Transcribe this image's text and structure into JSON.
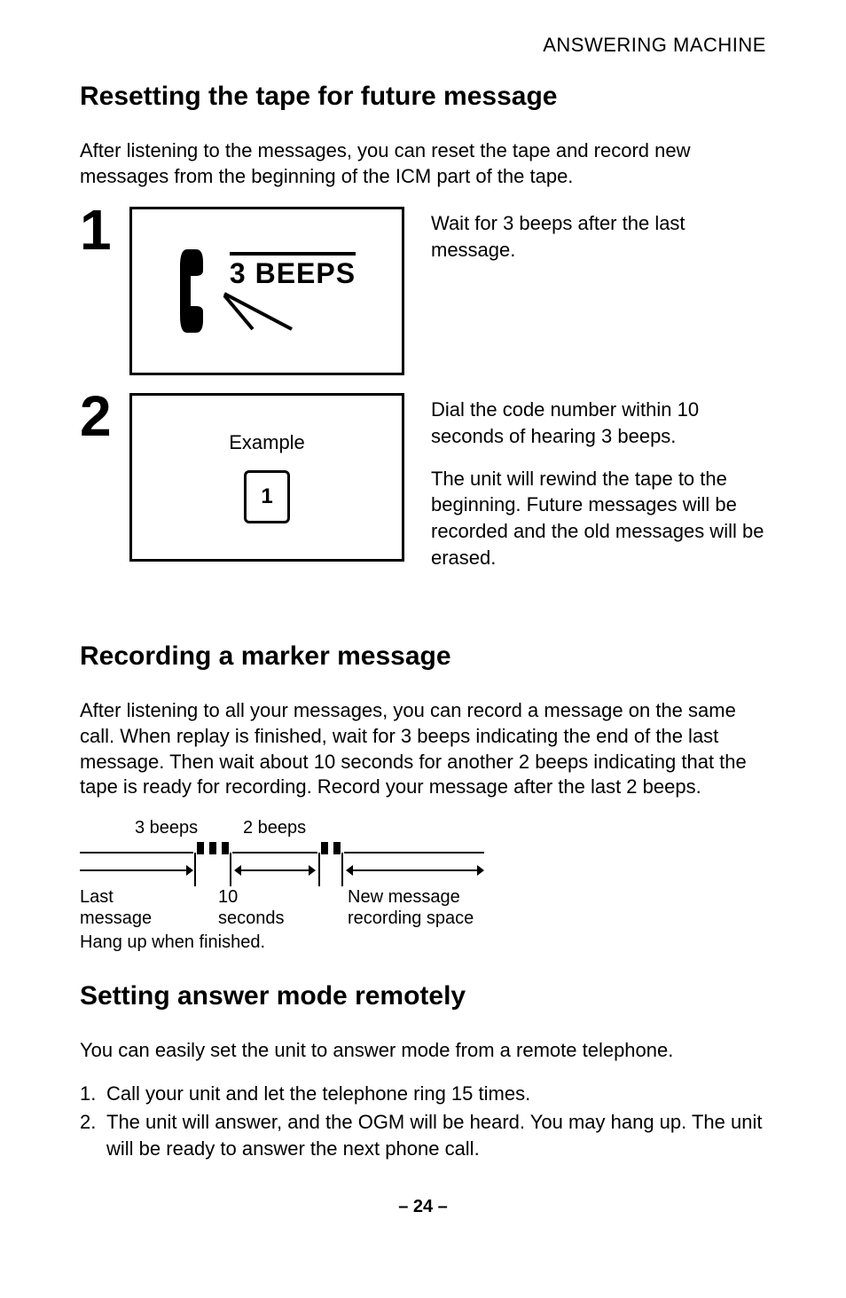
{
  "header": "ANSWERING MACHINE",
  "section1": {
    "title": "Resetting the tape for future message",
    "intro": "After listening to the messages, you can reset the tape and record new messages from the beginning of the ICM part of the tape.",
    "step1": {
      "num": "1",
      "beeps_label": "3 BEEPS",
      "text": "Wait for 3 beeps after the last message."
    },
    "step2": {
      "num": "2",
      "example_label": "Example",
      "key": "1",
      "text_a": "Dial the code number within 10 seconds of hearing 3 beeps.",
      "text_b": "The unit will rewind the tape to the beginning. Future messages will be recorded and the old messages will be erased."
    }
  },
  "section2": {
    "title": "Recording a marker message",
    "body": "After listening to all your messages, you can record a message on the same call. When replay is finished, wait for 3 beeps indicating the end of the last message. Then wait about 10 seconds for another 2 beeps indicating that the tape is ready for recording. Record your message after the last 2 beeps.",
    "diagram": {
      "label_3beeps": "3 beeps",
      "label_2beeps": "2 beeps",
      "last_message_l1": "Last",
      "last_message_l2": "message",
      "ten_l1": "10",
      "ten_l2": "seconds",
      "new_l1": "New message",
      "new_l2": "recording space",
      "hangup": "Hang up when finished."
    }
  },
  "section3": {
    "title": "Setting answer mode remotely",
    "intro": "You can easily set the unit to answer mode from a remote telephone.",
    "li1_n": "1.",
    "li1": "Call your unit and let the telephone ring 15 times.",
    "li2_n": "2.",
    "li2": "The unit will answer, and the OGM will be heard. You may hang up. The unit will be ready to answer the next phone call."
  },
  "page_number": "– 24 –"
}
